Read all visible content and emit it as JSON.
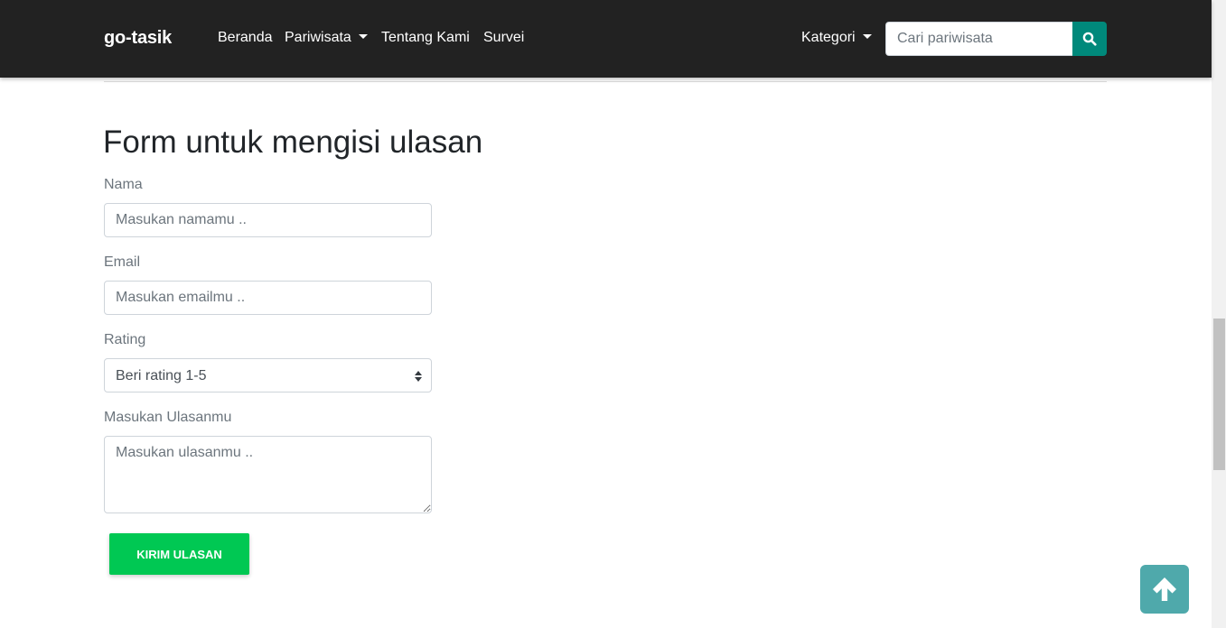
{
  "navbar": {
    "brand": "go-tasik",
    "links": [
      "Beranda",
      "Pariwisata",
      "Tentang Kami",
      "Survei"
    ],
    "kategori_label": "Kategori",
    "search_placeholder": "Cari pariwisata",
    "search_icon": "search-icon"
  },
  "form": {
    "title": "Form untuk mengisi ulasan",
    "name_label": "Nama",
    "name_placeholder": "Masukan namamu ..",
    "email_label": "Email",
    "email_placeholder": "Masukan emailmu ..",
    "rating_label": "Rating",
    "rating_selected": "Beri rating 1-5",
    "review_label": "Masukan Ulasanmu",
    "review_placeholder": "Masukan ulasanmu ..",
    "submit_label": "Kirim Ulasan"
  },
  "scroll_top_icon": "arrow-up-icon",
  "colors": {
    "navbar_bg": "#222222",
    "search_button": "#00897b",
    "submit_button": "#00c853",
    "scroll_top_button": "#4fa9ab"
  }
}
